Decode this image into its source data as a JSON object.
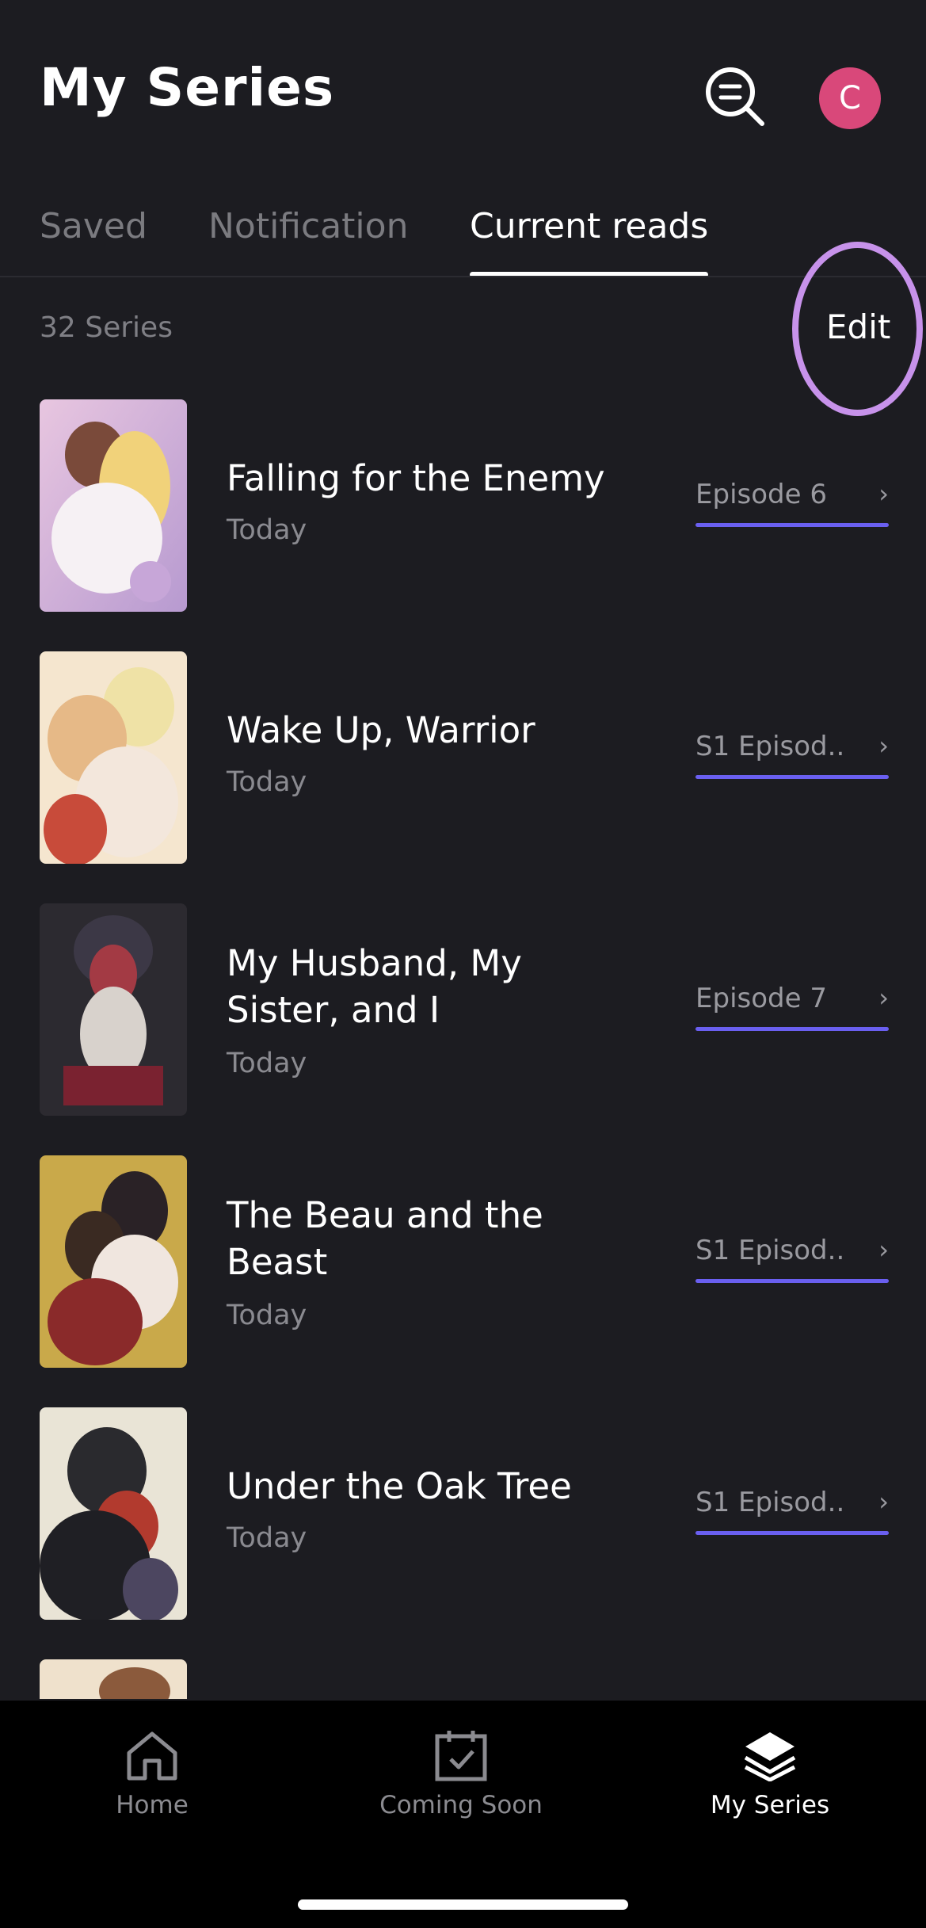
{
  "header": {
    "title": "My Series",
    "avatar_letter": "C"
  },
  "tabs": [
    {
      "label": "Saved",
      "active": false
    },
    {
      "label": "Notification",
      "active": false
    },
    {
      "label": "Current reads",
      "active": true
    }
  ],
  "toolbar": {
    "count": "32 Series",
    "edit_label": "Edit"
  },
  "series": [
    {
      "title": "Falling for the Enemy",
      "date": "Today",
      "episode": "Episode 6"
    },
    {
      "title": "Wake Up, Warrior",
      "date": "Today",
      "episode": "S1 Episod.."
    },
    {
      "title": "My Husband, My Sister, and I",
      "date": "Today",
      "episode": "Episode 7"
    },
    {
      "title": "The Beau and the Beast",
      "date": "Today",
      "episode": "S1 Episod.."
    },
    {
      "title": "Under the Oak Tree",
      "date": "Today",
      "episode": "S1 Episod.."
    }
  ],
  "nav": [
    {
      "label": "Home",
      "icon": "home-icon",
      "active": false
    },
    {
      "label": "Coming Soon",
      "icon": "calendar-check-icon",
      "active": false
    },
    {
      "label": "My Series",
      "icon": "layers-icon",
      "active": true
    }
  ],
  "colors": {
    "accent": "#6a5ff0",
    "avatar": "#d9487a",
    "highlight_circle": "#c792ea"
  },
  "chevron": "›"
}
